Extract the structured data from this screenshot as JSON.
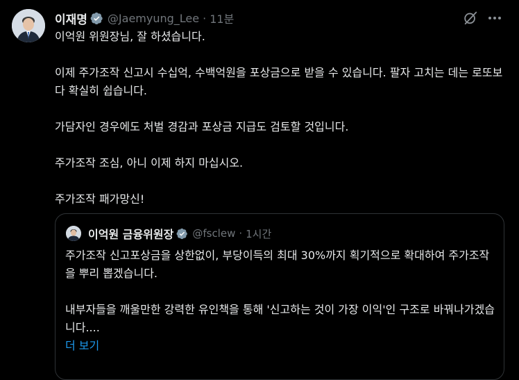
{
  "tweet": {
    "author_name": "이재명",
    "handle": "@Jaemyung_Lee",
    "separator": "·",
    "time": "11분",
    "paragraphs": [
      "이억원 위원장님, 잘 하셨습니다.",
      "이제 주가조작 신고시 수십억, 수백억원을 포상금으로 받을 수 있습니다. 팔자 고치는 데는 로또보다 확실히 쉽습니다.",
      "가담자인 경우에도 처벌 경감과 포상금 지급도 검토할 것입니다.",
      "주가조작 조심, 아니 이제 하지 마십시오.",
      "주가조작 패가망신!"
    ]
  },
  "quoted": {
    "author_name": "이억원 금융위원장",
    "handle": "@fsclew",
    "separator": "·",
    "time": "1시간",
    "paragraphs": [
      "주가조작 신고포상금을 상한없이, 부당이득의 최대 30%까지 획기적으로 확대하여 주가조작을 뿌리 뽑겠습니다.",
      "내부자들을 깨울만한 강력한 유인책을 통해 '신고하는 것이 가장 이익'인 구조로 바꿔나가겠습니다...."
    ],
    "show_more": "더 보기"
  },
  "icons": {
    "badge": "gray-verified-badge-icon",
    "grok": "grok-icon",
    "more": "more-options-icon"
  },
  "colors": {
    "background": "#000000",
    "text": "#e7e9ea",
    "secondary_text": "#71767b",
    "link": "#1d9bf0",
    "border": "#2f3336",
    "badge": "#829aab"
  }
}
